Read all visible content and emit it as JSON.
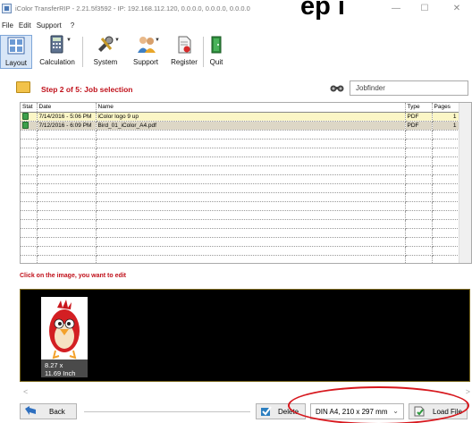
{
  "window": {
    "title": "iColor TransferRIP - 2.21.5f3592 - IP: 192.168.112.120, 0.0.0.0, 0.0.0.0, 0.0.0.0",
    "overlay_heading": "ep i",
    "minimize": "—",
    "maximize": "☐",
    "close": "✕"
  },
  "menu": [
    "File",
    "Edit",
    "Support",
    "?"
  ],
  "toolbar": {
    "layout": "Layout",
    "calculation": "Calculation",
    "system": "System",
    "support": "Support",
    "register": "Register",
    "quit": "Quit"
  },
  "step": {
    "title": "Step 2 of 5: Job selection",
    "jobfinder": "Jobfinder"
  },
  "table": {
    "headers": {
      "stat": "Stat",
      "date": "Date",
      "name": "Name",
      "type": "Type",
      "pages": "Pages"
    },
    "rows": [
      {
        "date": "7/14/2016 - 5:06 PM",
        "name": "iColor logo 9 up",
        "type": "PDF",
        "pages": "1"
      },
      {
        "date": "7/12/2016 - 6:09 PM",
        "name": "Bird_01_iColor_A4.pdf",
        "type": "PDF",
        "pages": "1"
      }
    ]
  },
  "hint": "Click on the image, you want to edit",
  "thumbnail": {
    "width_label": "8.27 x",
    "height_label": "11.69 Inch"
  },
  "scroll": {
    "left": "<",
    "right": ">"
  },
  "bottom": {
    "back": "Back",
    "delete": "Delete",
    "paper_size": "DIN A4, 210 x 297 mm",
    "load_file": "Load File"
  },
  "colors": {
    "accent_red": "#c0101a",
    "highlight_yellow": "#fbf6c6",
    "highlight_gray": "#ddd7c6",
    "annotation_red": "#d7181e"
  }
}
